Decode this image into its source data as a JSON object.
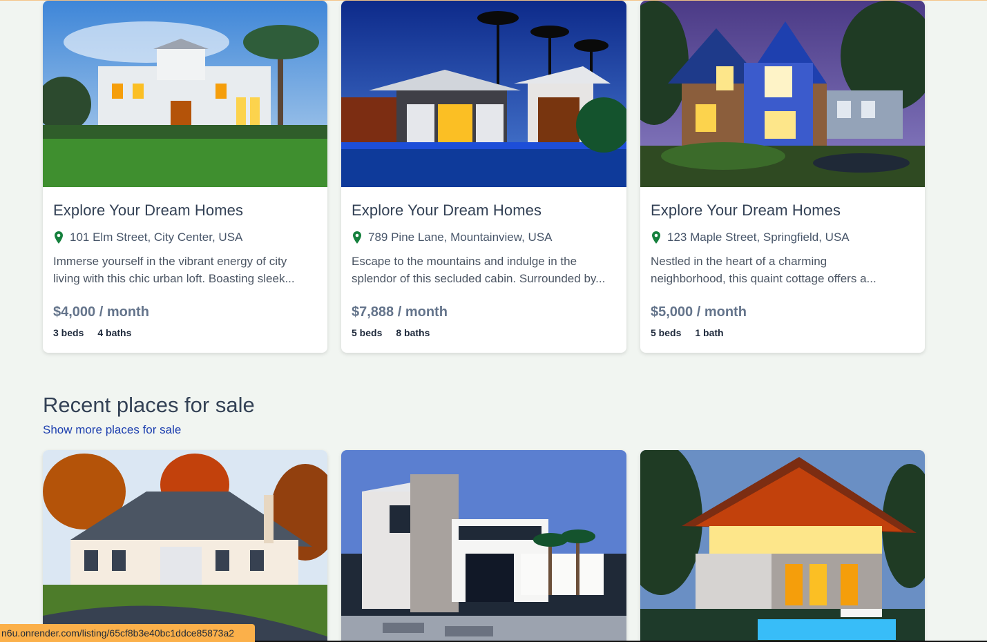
{
  "rent_listings": [
    {
      "title": "Explore Your Dream Homes",
      "address": "101 Elm Street, City Center, USA",
      "description_line1": "Immerse yourself in the vibrant energy of city",
      "description_line2": "living with this chic urban loft. Boasting sleek...",
      "price": "$4,000 / month",
      "beds": "3 beds",
      "baths": "4 baths"
    },
    {
      "title": "Explore Your Dream Homes",
      "address": "789 Pine Lane, Mountainview, USA",
      "description_line1": "Escape to the mountains and indulge in the",
      "description_line2": "splendor of this secluded cabin. Surrounded by...",
      "price": "$7,888 / month",
      "beds": "5 beds",
      "baths": "8 baths"
    },
    {
      "title": "Explore Your Dream Homes",
      "address": "123 Maple Street, Springfield, USA",
      "description_line1": "Nestled in the heart of a charming",
      "description_line2": "neighborhood, this quaint cottage offers a...",
      "price": "$5,000 / month",
      "beds": "5 beds",
      "baths": "1 bath"
    }
  ],
  "sale_section": {
    "title": "Recent places for sale",
    "show_more": "Show more places for sale"
  },
  "status_bar": {
    "url": "n6u.onrender.com/listing/65cf8b3e40bc1ddce85873a2"
  },
  "colors": {
    "background": "#f1f5f1",
    "pin": "#15803d",
    "link": "#1e40af",
    "status_bar": "#fbb04a"
  },
  "icons": [
    "location-pin-icon"
  ]
}
